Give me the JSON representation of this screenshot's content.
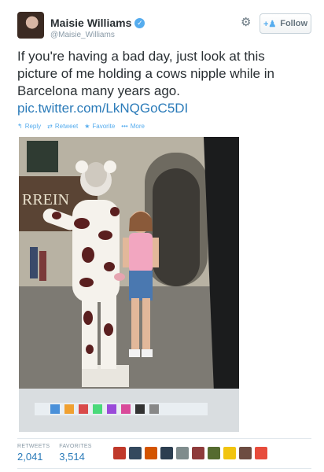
{
  "user": {
    "name": "Maisie Williams",
    "handle": "@Maisie_Williams"
  },
  "follow_label": "Follow",
  "tweet": {
    "text": "If you're having a bad day, just look at this picture of me holding a cows nipple while in Barcelona many years ago.",
    "link": "pic.twitter.com/LkNQGoC5DI"
  },
  "actions": {
    "reply": "Reply",
    "retweet": "Retweet",
    "favorite": "Favorite",
    "more": "More"
  },
  "photo": {
    "storefront_text": "RREIN"
  },
  "stats": {
    "retweets_label": "RETWEETS",
    "retweets_value": "2,041",
    "favorites_label": "FAVORITES",
    "favorites_value": "3,514"
  },
  "icons": {
    "verified": "verified-badge-icon",
    "settings": "gear-icon",
    "follow": "add-person-icon",
    "reply": "reply-icon",
    "retweet": "retweet-icon",
    "favorite": "star-icon",
    "more": "more-dots-icon"
  },
  "colors": {
    "link": "#2b7bb9",
    "accent": "#55acee",
    "muted": "#8899a6",
    "text": "#292f33"
  },
  "favoriter_colors": [
    "#c0392b",
    "#34495e",
    "#d35400",
    "#2c3e50",
    "#7f8c8d",
    "#8e3b3b",
    "#556b2f",
    "#f1c40f",
    "#6d4c41",
    "#e74c3c"
  ]
}
